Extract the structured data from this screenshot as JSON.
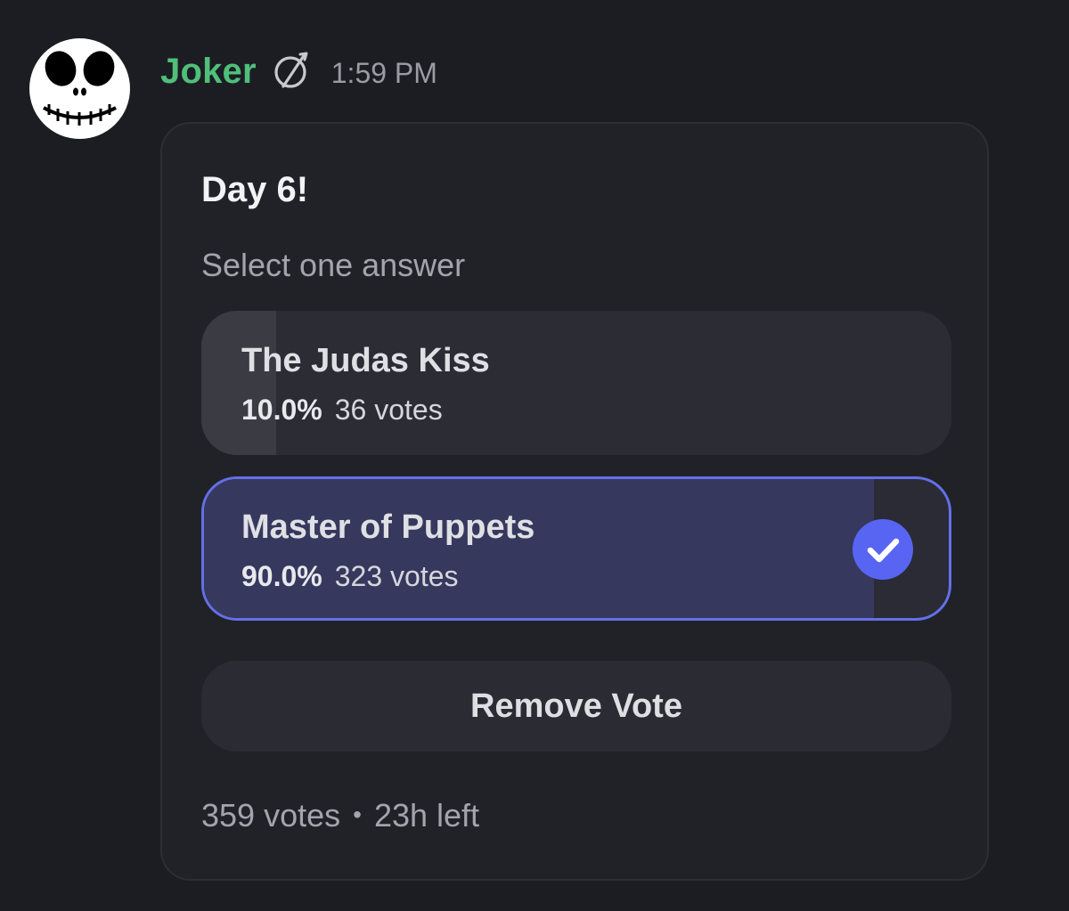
{
  "message": {
    "author": "Joker",
    "timestamp": "1:59 PM",
    "avatar_icon": "skull-avatar",
    "badge_icon": "slashed-circle-badge-icon",
    "author_color": "#4fbf7a"
  },
  "poll": {
    "question": "Day 6!",
    "instruction": "Select one answer",
    "options": [
      {
        "label": "The Judas Kiss",
        "percent": "10.0%",
        "votes": "36 votes",
        "share": 0.1,
        "selected": false
      },
      {
        "label": "Master of Puppets",
        "percent": "90.0%",
        "votes": "323 votes",
        "share": 0.9,
        "selected": true,
        "check_icon": "check-circle-icon"
      }
    ],
    "remove_vote_label": "Remove Vote",
    "total_votes": "359 votes",
    "separator": "•",
    "time_left": "23h left",
    "accent_color": "#5865f2"
  }
}
